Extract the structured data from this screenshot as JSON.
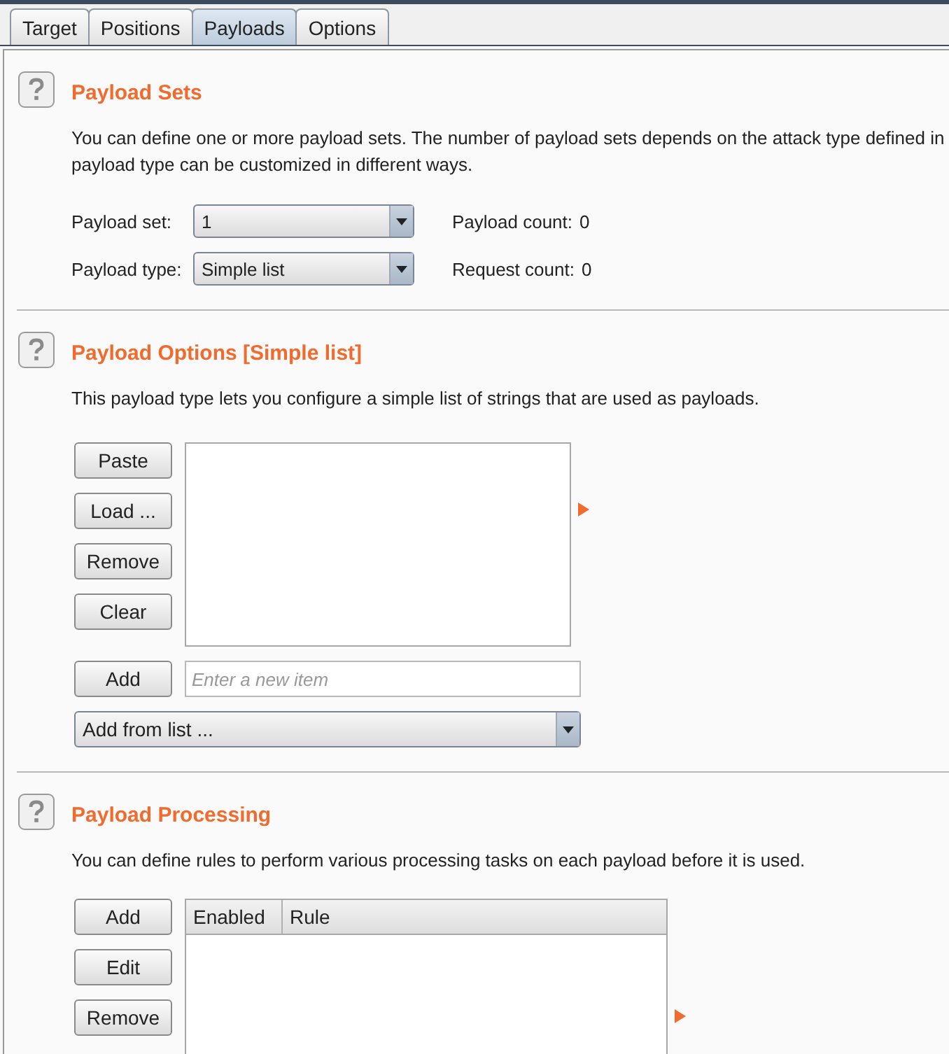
{
  "tabs": [
    {
      "label": "Target",
      "selected": false
    },
    {
      "label": "Positions",
      "selected": false
    },
    {
      "label": "Payloads",
      "selected": true
    },
    {
      "label": "Options",
      "selected": false
    }
  ],
  "sections": [
    {
      "kind": "sets",
      "title": "Payload Sets",
      "description": "You can define one or more payload sets. The number of payload sets depends on the attack type defined in\npayload type can be customized in different ways.",
      "fields": [
        {
          "label": "Payload set:",
          "value": "1",
          "info_label": "Payload count:",
          "info_value": "0"
        },
        {
          "label": "Payload type:",
          "value": "Simple list",
          "info_label": "Request count:",
          "info_value": "0"
        }
      ]
    },
    {
      "kind": "list",
      "title": "Payload Options [Simple list]",
      "description": "This payload type lets you configure a simple list of strings that are used as payloads.",
      "buttons": [
        "Paste",
        "Load ...",
        "Remove",
        "Clear"
      ],
      "add_button": "Add",
      "new_item": {
        "placeholder": "Enter a new item"
      },
      "dropdown": "Add from list ..."
    },
    {
      "kind": "table",
      "title": "Payload Processing",
      "description": "You can define rules to perform various processing tasks on each payload before it is used.",
      "buttons": [
        "Add",
        "Edit",
        "Remove"
      ],
      "columns": [
        "Enabled",
        "Rule"
      ]
    }
  ]
}
